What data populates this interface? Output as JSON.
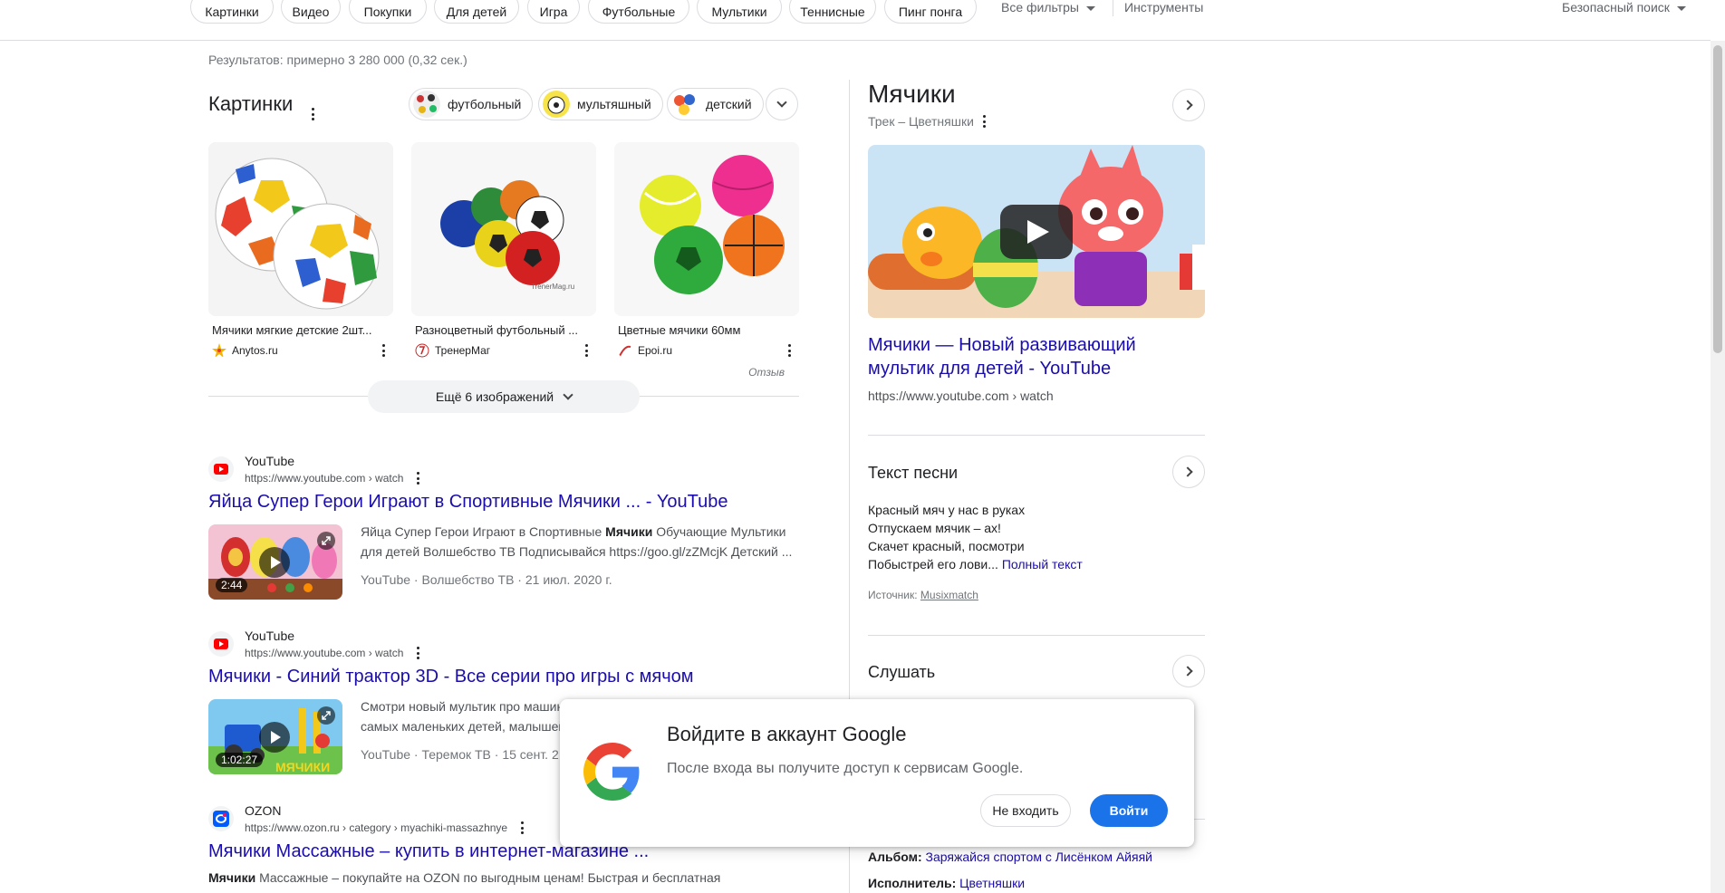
{
  "filters": {
    "chips": [
      "Картинки",
      "Видео",
      "Покупки",
      "Для детей",
      "Игра",
      "Футбольные",
      "Мультики",
      "Теннисные",
      "Пинг понга"
    ],
    "all_filters": "Все фильтры",
    "tools": "Инструменты",
    "safe_search": "Безопасный поиск"
  },
  "stats": "Результатов: примерно 3 280 000 (0,32 сек.)",
  "images": {
    "title": "Картинки",
    "refine": [
      "футбольный",
      "мультяшный",
      "детский"
    ],
    "items": [
      {
        "caption": "Мячики мягкие детские 2шт...",
        "source": "Anytos.ru"
      },
      {
        "caption": "Разноцветный футбольный ...",
        "source": "ТренерМаг"
      },
      {
        "caption": "Цветные мячики 60мм",
        "source": "Epoi.ru"
      }
    ],
    "watermark": "TrenerMag.ru",
    "feedback": "Отзыв",
    "more": "Ещё 6 изображений"
  },
  "results": [
    {
      "site": "YouTube",
      "url": "https://www.youtube.com › watch",
      "title": "Яйца Супер Герои Играют в Спортивные Мячики ... - YouTube",
      "snippet_pre": "Яйца Супер Герои Играют в Спортивные ",
      "snippet_bold": "Мячики",
      "snippet_post": " Обучающие Мультики для детей Волшебство ТВ Подписывайся https://goo.gl/zZMcjK Детский ...",
      "duration": "2:44",
      "meta": "YouTube · Волшебство ТВ · 21 июл. 2020 г."
    },
    {
      "site": "YouTube",
      "url": "https://www.youtube.com › watch",
      "title": "Мячики - Синий трактор 3D - Все серии про игры с мячом",
      "snippet_pre": "Смотри новый мультик про машин",
      "snippet_line2": "самых маленьких детей, малышей",
      "duration": "1:02:27",
      "thumb_text": "МЯЧИКИ",
      "meta": "YouTube · Теремок ТВ · 15 сент. 2"
    },
    {
      "site": "OZON",
      "url": "https://www.ozon.ru › category › myachiki-massazhnye",
      "title": "Мячики Массажные – купить в интернет-магазине ...",
      "snippet_bold": "Мячики",
      "snippet_post": " Массажные – покупайте на OZON по выгодным ценам! Быстрая и бесплатная"
    }
  ],
  "knowledge": {
    "title": "Мячики",
    "subtitle": "Трек – Цветняшки",
    "video_title": "Мячики — Новый развивающий мультик для детей - YouTube",
    "video_url": "https://www.youtube.com › watch",
    "lyrics_heading": "Текст песни",
    "lyrics": [
      "Красный мяч у нас в руках",
      "Отпускаем мячик – ах!",
      "Скачет красный, посмотри",
      "Побыстрей его лови..."
    ],
    "full_text": "Полный текст",
    "source_label": "Источник:",
    "source_name": "Musixmatch",
    "listen": "Слушать",
    "album_label": "Альбом:",
    "album_value": "Заряжайся спортом с Лисёнком Айяяй",
    "artist_label": "Исполнитель:",
    "artist_value": "Цветняшки"
  },
  "dialog": {
    "title": "Войдите в аккаунт Google",
    "text": "После входа вы получите доступ к сервисам Google.",
    "decline": "Не входить",
    "accept": "Войти"
  },
  "colors": {
    "link": "#1a0dab",
    "accent": "#1a73e8",
    "border": "#dadce0"
  }
}
